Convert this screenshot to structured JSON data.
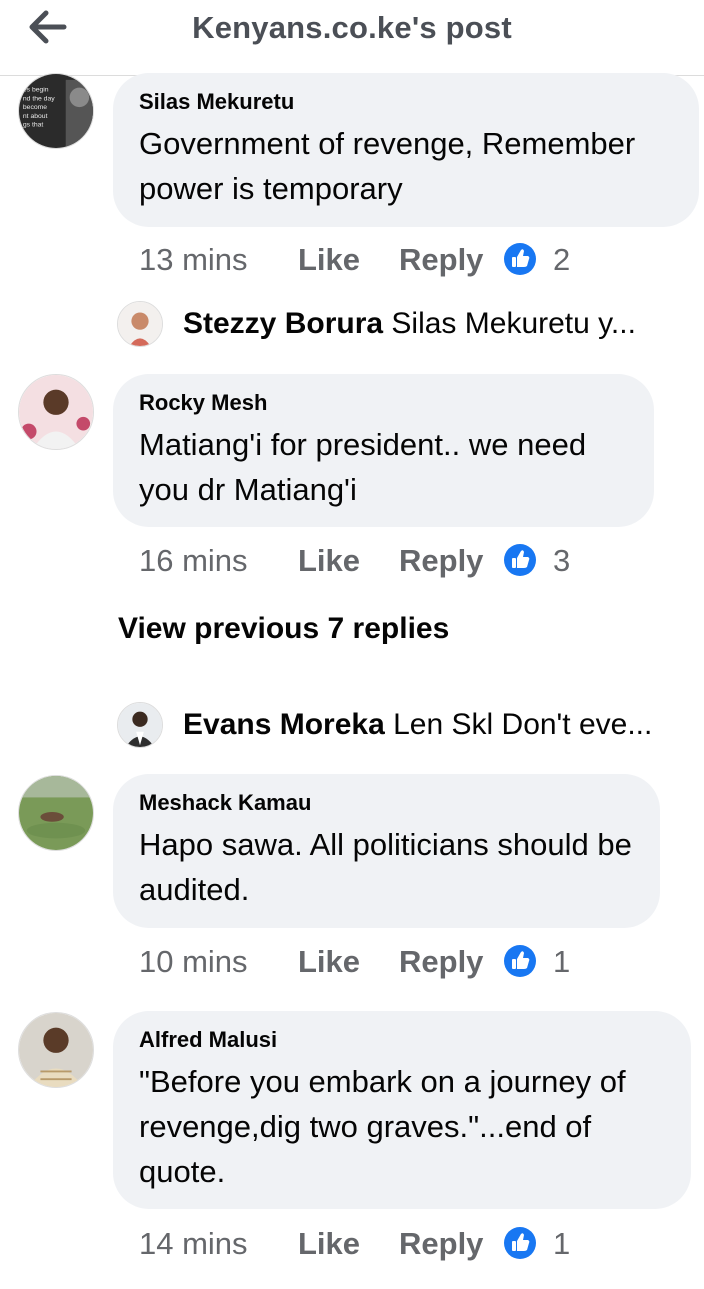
{
  "header": {
    "title": "Kenyans.co.ke's post"
  },
  "comments": [
    {
      "author": "Silas Mekuretu",
      "text": "Government of revenge, Remember power is temporary",
      "time": "13 mins",
      "like": "Like",
      "reply": "Reply",
      "reactions": "2",
      "avatar_caption": [
        "es begin",
        "nd the day",
        "become",
        "nt about",
        "gs that"
      ]
    },
    {
      "author": "Rocky Mesh",
      "text": "Matiang'i for president.. we need you dr Matiang'i",
      "time": "16 mins",
      "like": "Like",
      "reply": "Reply",
      "reactions": "3"
    },
    {
      "author": "Meshack Kamau",
      "text": "Hapo sawa. All politicians should be audited.",
      "time": "10 mins",
      "like": "Like",
      "reply": "Reply",
      "reactions": "1"
    },
    {
      "author": "Alfred Malusi",
      "text": "\"Before you embark on a journey of revenge,dig two graves.\"...end of quote.",
      "time": "14 mins",
      "like": "Like",
      "reply": "Reply",
      "reactions": "1"
    }
  ],
  "reply_previews": [
    {
      "name": "Stezzy Borura",
      "text": "Silas Mekuretu y..."
    },
    {
      "name": "Evans Moreka",
      "text": "Len Skl Don't eve..."
    }
  ],
  "view_previous": "View previous 7 replies",
  "icons": {
    "back": "arrow-left-icon",
    "reaction": "like-thumb-icon"
  },
  "colors": {
    "bubble": "#f0f2f5",
    "meta": "#65676b",
    "like_blue": "#1877f2",
    "header_text": "#4b4f56"
  }
}
